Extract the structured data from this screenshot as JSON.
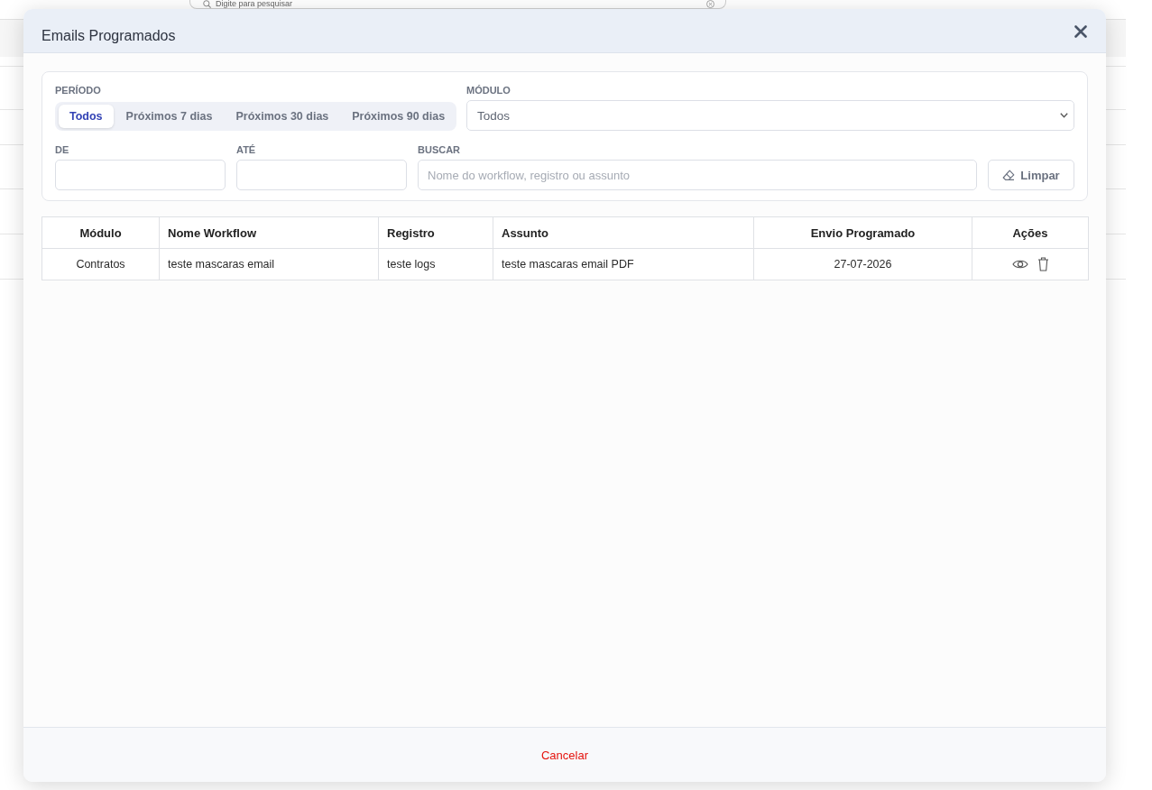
{
  "background_page": {
    "search": {
      "placeholder": "Digite para pesquisar"
    }
  },
  "dialog": {
    "title": "Emails Programados",
    "filters": {
      "period": {
        "label": "PERÍODO",
        "options": [
          {
            "label": "Todos",
            "selected": true
          },
          {
            "label": "Próximos 7 dias",
            "selected": false
          },
          {
            "label": "Próximos 30 dias",
            "selected": false
          },
          {
            "label": "Próximos 90 dias",
            "selected": false
          }
        ]
      },
      "module": {
        "label": "MÓDULO",
        "value": "Todos"
      },
      "from": {
        "label": "DE"
      },
      "to": {
        "label": "ATÉ"
      },
      "search": {
        "label": "BUSCAR",
        "placeholder": "Nome do workflow, registro ou assunto"
      },
      "clear_button": "Limpar"
    },
    "table": {
      "columns": [
        "Módulo",
        "Nome Workflow",
        "Registro",
        "Assunto",
        "Envio Programado",
        "Ações"
      ],
      "rows": [
        {
          "cells": [
            "Contratos",
            "teste mascaras email",
            "teste logs",
            "teste mascaras email PDF",
            "27-07-2026"
          ]
        }
      ]
    },
    "footer": {
      "cancel_button": "Cancelar"
    }
  }
}
